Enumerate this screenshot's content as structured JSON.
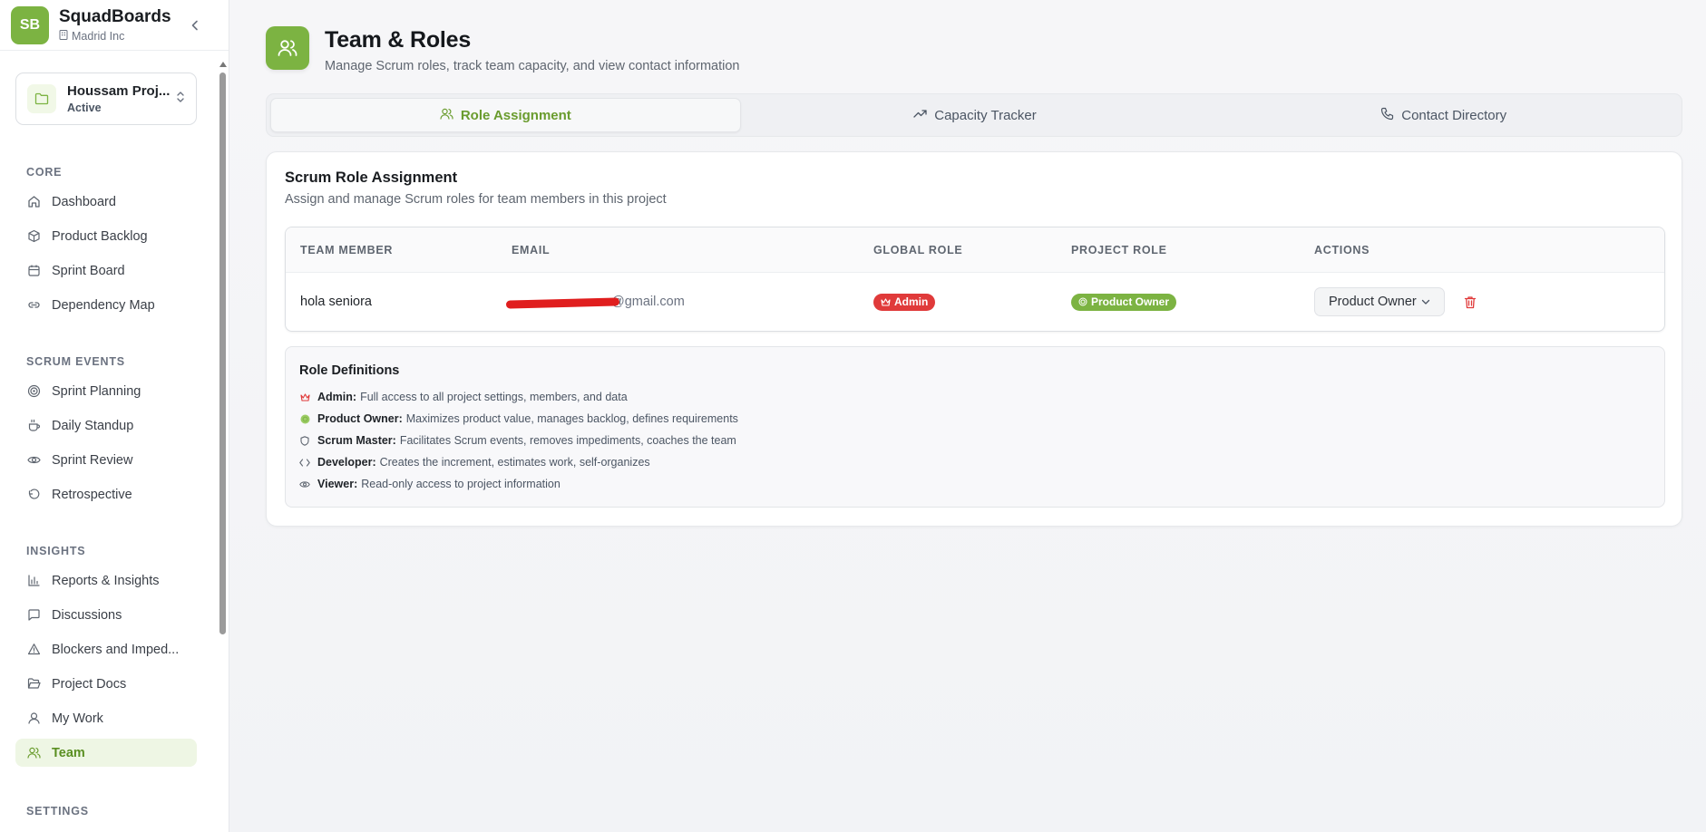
{
  "brand": {
    "logo_text": "SB",
    "name": "SquadBoards",
    "org": "Madrid Inc"
  },
  "project": {
    "name": "Houssam Proj...",
    "status": "Active"
  },
  "nav": {
    "core": {
      "heading": "CORE",
      "items": [
        "Dashboard",
        "Product Backlog",
        "Sprint Board",
        "Dependency Map"
      ]
    },
    "scrum": {
      "heading": "SCRUM EVENTS",
      "items": [
        "Sprint Planning",
        "Daily Standup",
        "Sprint Review",
        "Retrospective"
      ]
    },
    "insights": {
      "heading": "INSIGHTS",
      "items": [
        "Reports & Insights",
        "Discussions",
        "Blockers and Imped...",
        "Project Docs",
        "My Work",
        "Team"
      ]
    },
    "settings": {
      "heading": "SETTINGS"
    }
  },
  "header": {
    "title": "Team & Roles",
    "subtitle": "Manage Scrum roles, track team capacity, and view contact information"
  },
  "tabs": [
    "Role Assignment",
    "Capacity Tracker",
    "Contact Directory"
  ],
  "card": {
    "title": "Scrum Role Assignment",
    "description": "Assign and manage Scrum roles for team members in this project"
  },
  "table": {
    "columns": [
      "TEAM MEMBER",
      "EMAIL",
      "GLOBAL ROLE",
      "PROJECT ROLE",
      "ACTIONS"
    ],
    "rows": [
      {
        "member": "hola seniora",
        "email_visible": "@gmail.com",
        "global_role": "Admin",
        "project_role": "Product Owner",
        "action_value": "Product Owner"
      }
    ]
  },
  "definitions": {
    "title": "Role Definitions",
    "items": [
      {
        "name": "Admin:",
        "text": "Full access to all project settings, members, and data"
      },
      {
        "name": "Product Owner:",
        "text": "Maximizes product value, manages backlog, defines requirements"
      },
      {
        "name": "Scrum Master:",
        "text": "Facilitates Scrum events, removes impediments, coaches the team"
      },
      {
        "name": "Developer:",
        "text": "Creates the increment, estimates work, self-organizes"
      },
      {
        "name": "Viewer:",
        "text": "Read-only access to project information"
      }
    ]
  },
  "colors": {
    "accent": "#7cb342",
    "admin": "#e03a3a",
    "active_nav_bg": "#eef6e4"
  }
}
